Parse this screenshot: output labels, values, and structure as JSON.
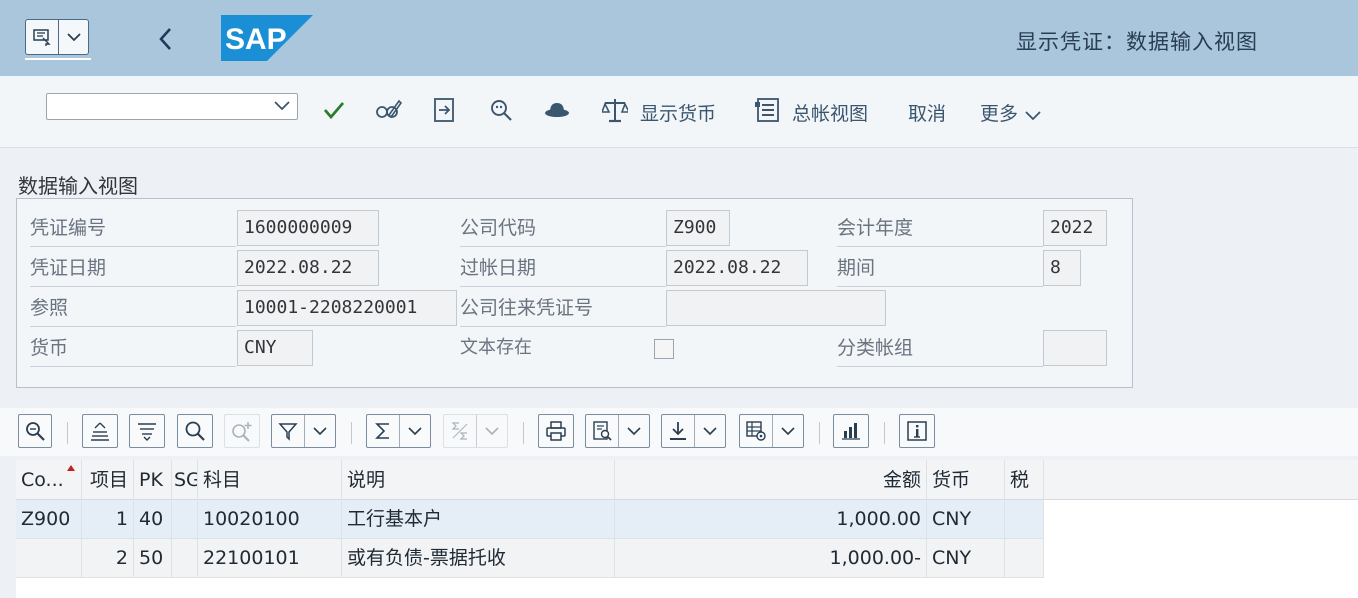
{
  "shell": {
    "title": "显示凭证：数据输入视图",
    "logo_text": "SAP"
  },
  "toolbar": {
    "command_placeholder": "",
    "show_currency": "显示货币",
    "gl_view": "总帐视图",
    "cancel": "取消",
    "more": "更多"
  },
  "form": {
    "section_title": "数据输入视图",
    "doc_number_label": "凭证编号",
    "doc_number": "1600000009",
    "company_code_label": "公司代码",
    "company_code": "Z900",
    "fiscal_year_label": "会计年度",
    "fiscal_year": "2022",
    "doc_date_label": "凭证日期",
    "doc_date": "2022.08.22",
    "posting_date_label": "过帐日期",
    "posting_date": "2022.08.22",
    "period_label": "期间",
    "period": "8",
    "reference_label": "参照",
    "reference": "10001-2208220001",
    "intercompany_label": "公司往来凭证号",
    "intercompany": "",
    "currency_label": "货币",
    "currency": "CNY",
    "text_exists_label": "文本存在",
    "ledger_group_label": "分类帐组",
    "ledger_group": ""
  },
  "table": {
    "columns": [
      "Co...",
      "项目",
      "PK",
      "SG",
      "科目",
      "说明",
      "金额",
      "货币",
      "税"
    ],
    "rows": [
      {
        "co": "Z900",
        "item": "1",
        "pk": "40",
        "sg": "",
        "account": "10020100",
        "desc": "工行基本户",
        "amount": "1,000.00",
        "currency": "CNY",
        "tax": ""
      },
      {
        "co": "",
        "item": "2",
        "pk": "50",
        "sg": "",
        "account": "22100101",
        "desc": "或有负债-票据托收",
        "amount": "1,000.00-",
        "currency": "CNY",
        "tax": ""
      }
    ]
  },
  "colors": {
    "shell_bg": "#a9c6dd",
    "check_green": "#2b7d2b",
    "toolbar_icon": "#3b566f"
  }
}
